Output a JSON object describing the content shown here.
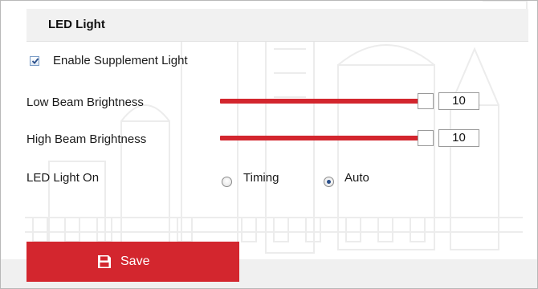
{
  "panel": {
    "title": "LED Light"
  },
  "supplement_light": {
    "label": "Enable Supplement Light",
    "checked": true
  },
  "low_beam": {
    "label": "Low Beam Brightness",
    "value": "10",
    "level": 1.0
  },
  "high_beam": {
    "label": "High Beam Brightness",
    "value": "10",
    "level": 1.0
  },
  "led_light_on": {
    "label": "LED Light On",
    "options": [
      {
        "label": "Timing",
        "selected": false
      },
      {
        "label": "Auto",
        "selected": true
      }
    ]
  },
  "actions": {
    "save_label": "Save"
  },
  "icons": {
    "save": "floppy-disk-icon",
    "check": "checkmark-icon"
  },
  "colors": {
    "accent": "#d3262e",
    "header_bg": "#f1f1f1"
  }
}
